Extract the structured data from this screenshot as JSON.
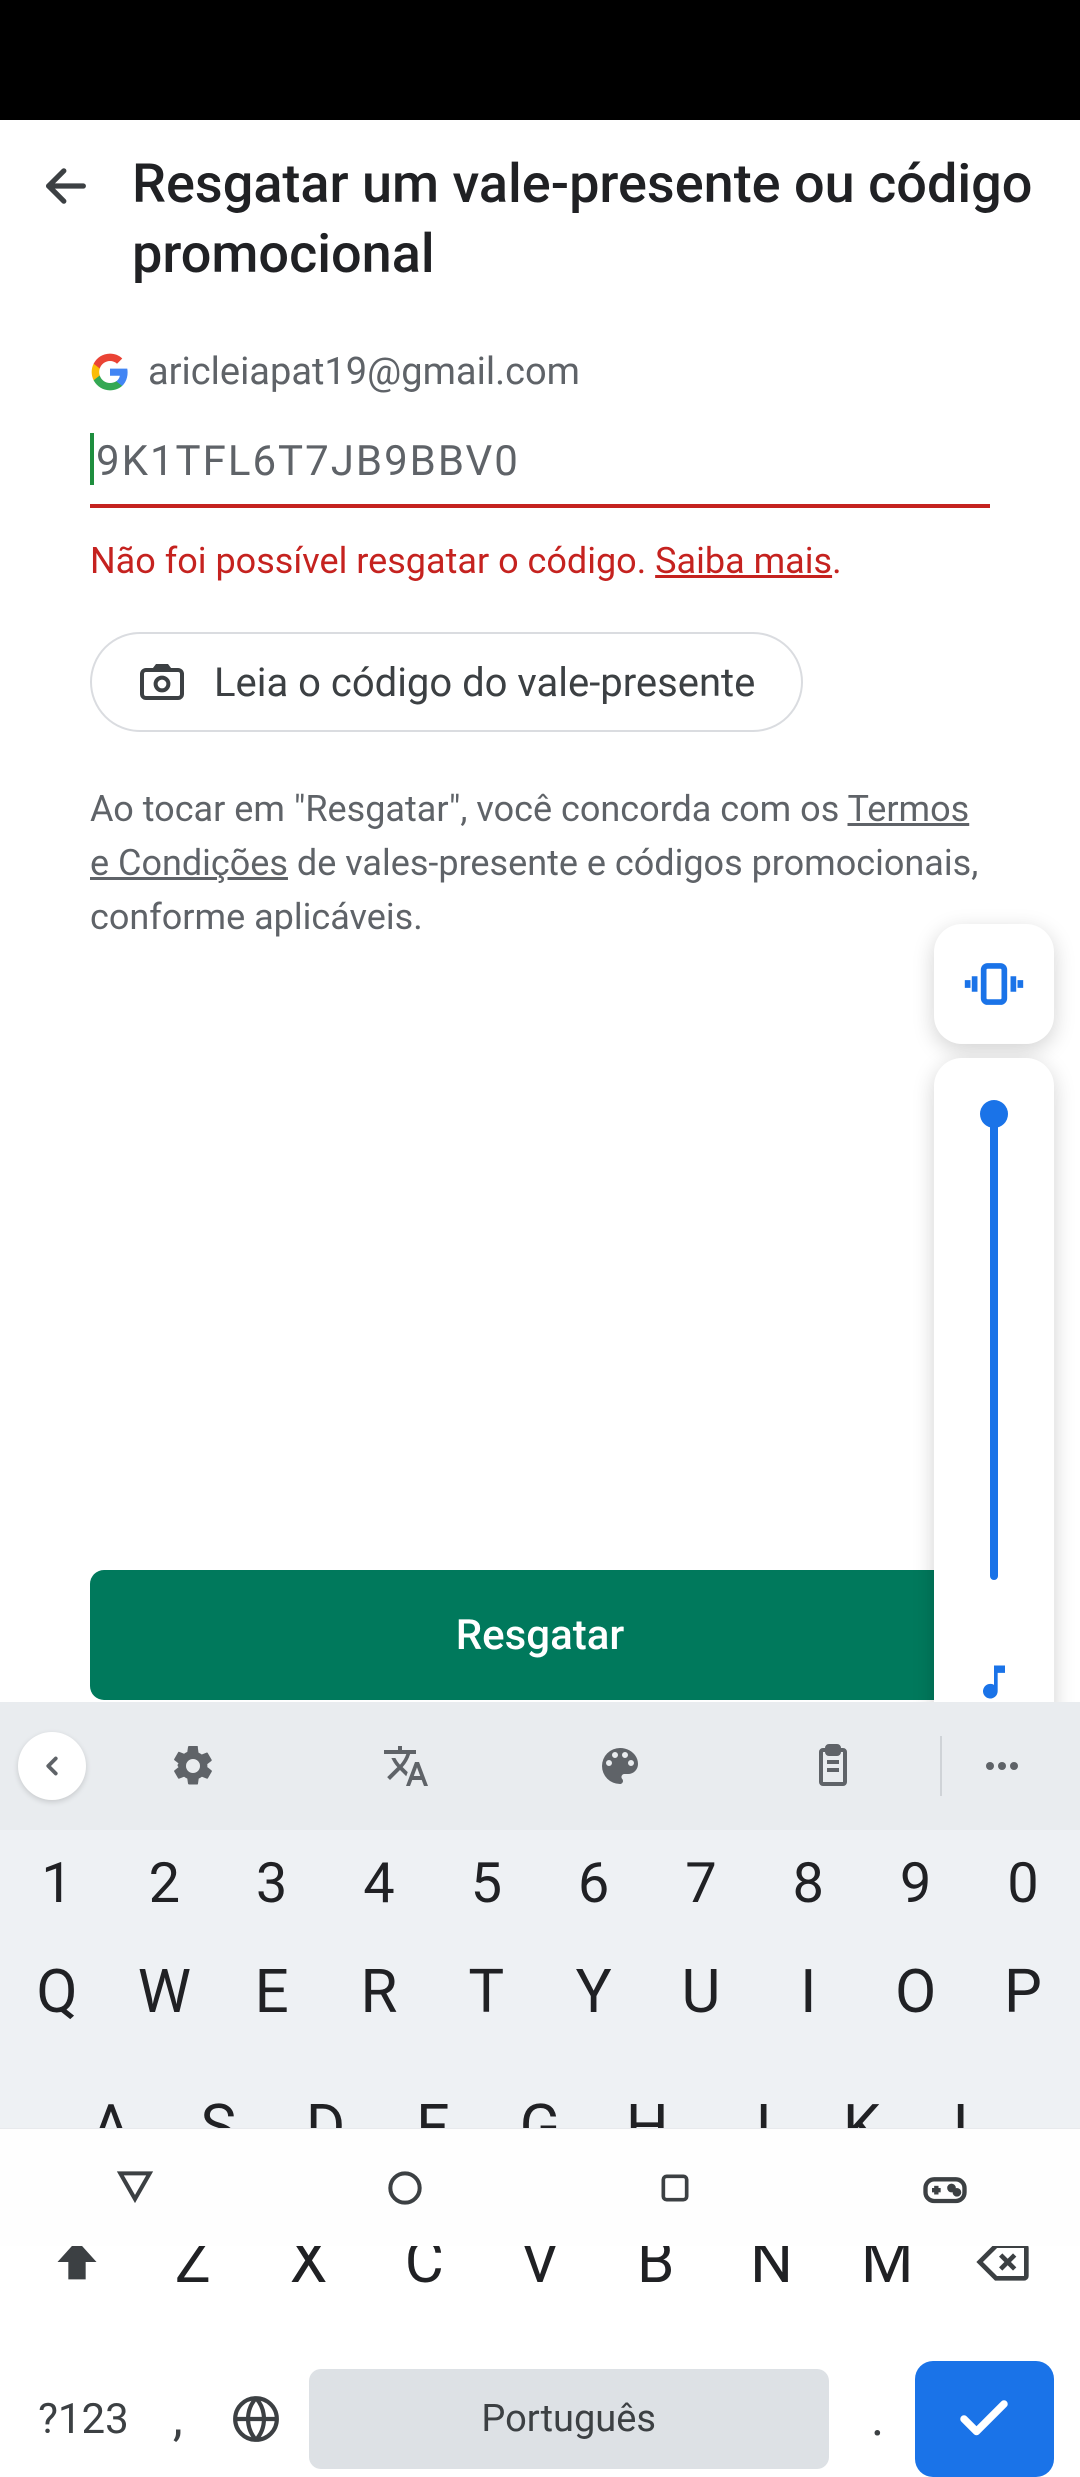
{
  "header": {
    "title": "Resgatar um vale-presente ou código promocional"
  },
  "account": {
    "email": "aricleiapat19@gmail.com"
  },
  "input": {
    "code_value": "9K1TFL6T7JB9BBV0"
  },
  "error": {
    "message": "Não foi possível resgatar o código. ",
    "link_text": "Saiba mais",
    "period": "."
  },
  "scan": {
    "label": "Leia o código do vale-presente"
  },
  "terms": {
    "prefix": "Ao tocar em \"Resgatar\", você concorda com os ",
    "link1": "Termos e Condições",
    "suffix": " de vales-presente e códigos promocionais, conforme aplicáveis."
  },
  "redeem": {
    "label": "Resgatar"
  },
  "keyboard": {
    "numbers": [
      "1",
      "2",
      "3",
      "4",
      "5",
      "6",
      "7",
      "8",
      "9",
      "0"
    ],
    "row1": [
      "Q",
      "W",
      "E",
      "R",
      "T",
      "Y",
      "U",
      "I",
      "O",
      "P"
    ],
    "row2": [
      "A",
      "S",
      "D",
      "F",
      "G",
      "H",
      "J",
      "K",
      "L"
    ],
    "row3": [
      "Z",
      "X",
      "C",
      "V",
      "B",
      "N",
      "M"
    ],
    "symbols": "?123",
    "space": "Português",
    "comma": ",",
    "dot": "."
  }
}
